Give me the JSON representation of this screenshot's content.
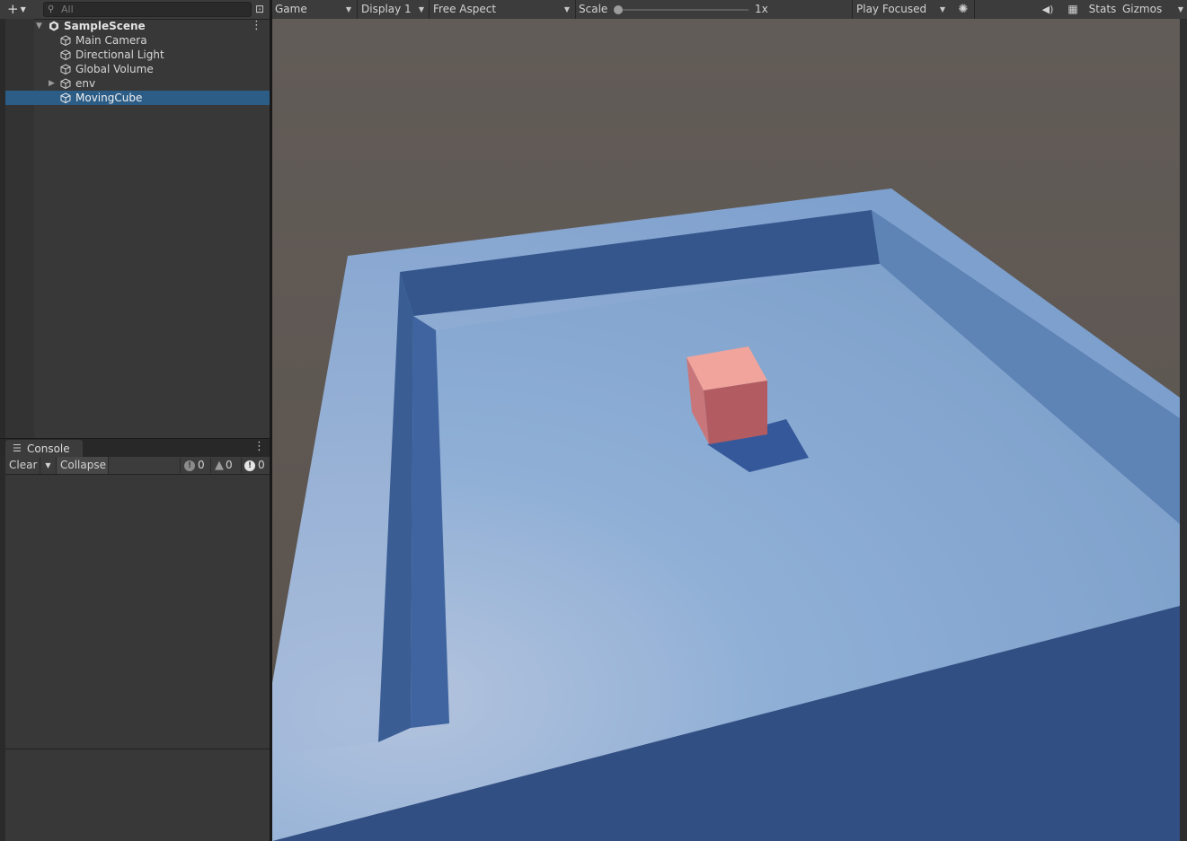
{
  "hierarchy": {
    "add_icon": "plus-icon",
    "search": {
      "placeholder": "All"
    },
    "scene": {
      "name": "SampleScene",
      "icon": "unity-scene-icon"
    },
    "items": [
      {
        "label": "Main Camera",
        "icon": "gameobject-cube-icon",
        "selected": false,
        "has_children": false
      },
      {
        "label": "Directional Light",
        "icon": "gameobject-cube-icon",
        "selected": false,
        "has_children": false
      },
      {
        "label": "Global Volume",
        "icon": "gameobject-cube-icon",
        "selected": false,
        "has_children": false
      },
      {
        "label": "env",
        "icon": "gameobject-cube-icon",
        "selected": false,
        "has_children": true
      },
      {
        "label": "MovingCube",
        "icon": "gameobject-cube-icon",
        "selected": true,
        "has_children": false
      }
    ],
    "selection_color": "#2c5d87"
  },
  "console": {
    "tab_label": "Console",
    "clear_label": "Clear",
    "collapse_label": "Collapse",
    "info_count": "0",
    "warning_count": "0",
    "error_count": "0"
  },
  "game_toolbar": {
    "view_label": "Game",
    "display_label": "Display 1",
    "aspect_label": "Free Aspect",
    "scale_label": "Scale",
    "scale_value": "1x",
    "play_mode_label": "Play Focused",
    "stats_label": "Stats",
    "gizmos_label": "Gizmos"
  },
  "colors": {
    "panel_bg": "#383838",
    "toolbar_bg": "#3c3c3c",
    "sky": "#5f5955",
    "platform_top": "#86a8d4",
    "platform_side": "#324f84",
    "cube_top": "#f0a49b",
    "cube_front": "#b25c62",
    "cube_shadow": "#34589a"
  }
}
